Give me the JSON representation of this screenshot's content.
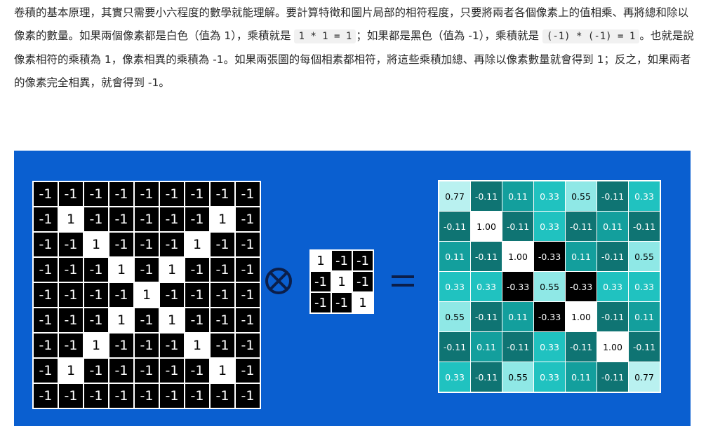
{
  "paragraph": {
    "s1": "卷積的基本原理，其實只需要小六程度的數學就能理解。要計算特徵和圖片局部的相符程度，只要將兩者各個像素上的值相乘、再將總和除以像素的數量。如果兩個像素都是白色（值為 1），乘積就是 ",
    "code1": "1 * 1 = 1",
    "s2": "；如果都是黑色（值為 -1），乘積就是 ",
    "code2": "(-1) * (-1) = 1",
    "s3": "。也就是說像素相符的乘積為 1，像素相異的乘積為 -1。如果兩張圖的每個相素都相符，將這些乘積加總、再除以像素數量就會得到 1；反之，如果兩者的像素完全相異，就會得到 -1。"
  },
  "figure": {
    "background": "#0a5fd0",
    "input_grid": [
      [
        -1,
        -1,
        -1,
        -1,
        -1,
        -1,
        -1,
        -1,
        -1
      ],
      [
        -1,
        1,
        -1,
        -1,
        -1,
        -1,
        -1,
        1,
        -1
      ],
      [
        -1,
        -1,
        1,
        -1,
        -1,
        -1,
        1,
        -1,
        -1
      ],
      [
        -1,
        -1,
        -1,
        1,
        -1,
        1,
        -1,
        -1,
        -1
      ],
      [
        -1,
        -1,
        -1,
        -1,
        1,
        -1,
        -1,
        -1,
        -1
      ],
      [
        -1,
        -1,
        -1,
        1,
        -1,
        1,
        -1,
        -1,
        -1
      ],
      [
        -1,
        -1,
        1,
        -1,
        -1,
        -1,
        1,
        -1,
        -1
      ],
      [
        -1,
        1,
        -1,
        -1,
        -1,
        -1,
        -1,
        1,
        -1
      ],
      [
        -1,
        -1,
        -1,
        -1,
        -1,
        -1,
        -1,
        -1,
        -1
      ]
    ],
    "kernel_grid": [
      [
        1,
        -1,
        -1
      ],
      [
        -1,
        1,
        -1
      ],
      [
        -1,
        -1,
        1
      ]
    ],
    "result_grid": [
      [
        "0.77",
        "-0.11",
        "0.11",
        "0.33",
        "0.55",
        "-0.11",
        "0.33"
      ],
      [
        "-0.11",
        "1.00",
        "-0.11",
        "0.33",
        "-0.11",
        "0.11",
        "-0.11"
      ],
      [
        "0.11",
        "-0.11",
        "1.00",
        "-0.33",
        "0.11",
        "-0.11",
        "0.55"
      ],
      [
        "0.33",
        "0.33",
        "-0.33",
        "0.55",
        "-0.33",
        "0.33",
        "0.33"
      ],
      [
        "0.55",
        "-0.11",
        "0.11",
        "-0.33",
        "1.00",
        "-0.11",
        "0.11"
      ],
      [
        "-0.11",
        "0.11",
        "-0.11",
        "0.33",
        "-0.11",
        "1.00",
        "-0.11"
      ],
      [
        "0.33",
        "-0.11",
        "0.55",
        "0.33",
        "0.11",
        "-0.11",
        "0.77"
      ]
    ],
    "result_colors": {
      "1.00": "#ffffff",
      "0.77": "#b9f1f0",
      "0.55": "#8fe8e6",
      "0.33": "#20c2c0",
      "0.11": "#139f9d",
      "-0.11": "#0f7473",
      "-0.33": "#000000"
    },
    "operator_icon": "otimes-icon",
    "equals_icon": "equals-icon"
  }
}
